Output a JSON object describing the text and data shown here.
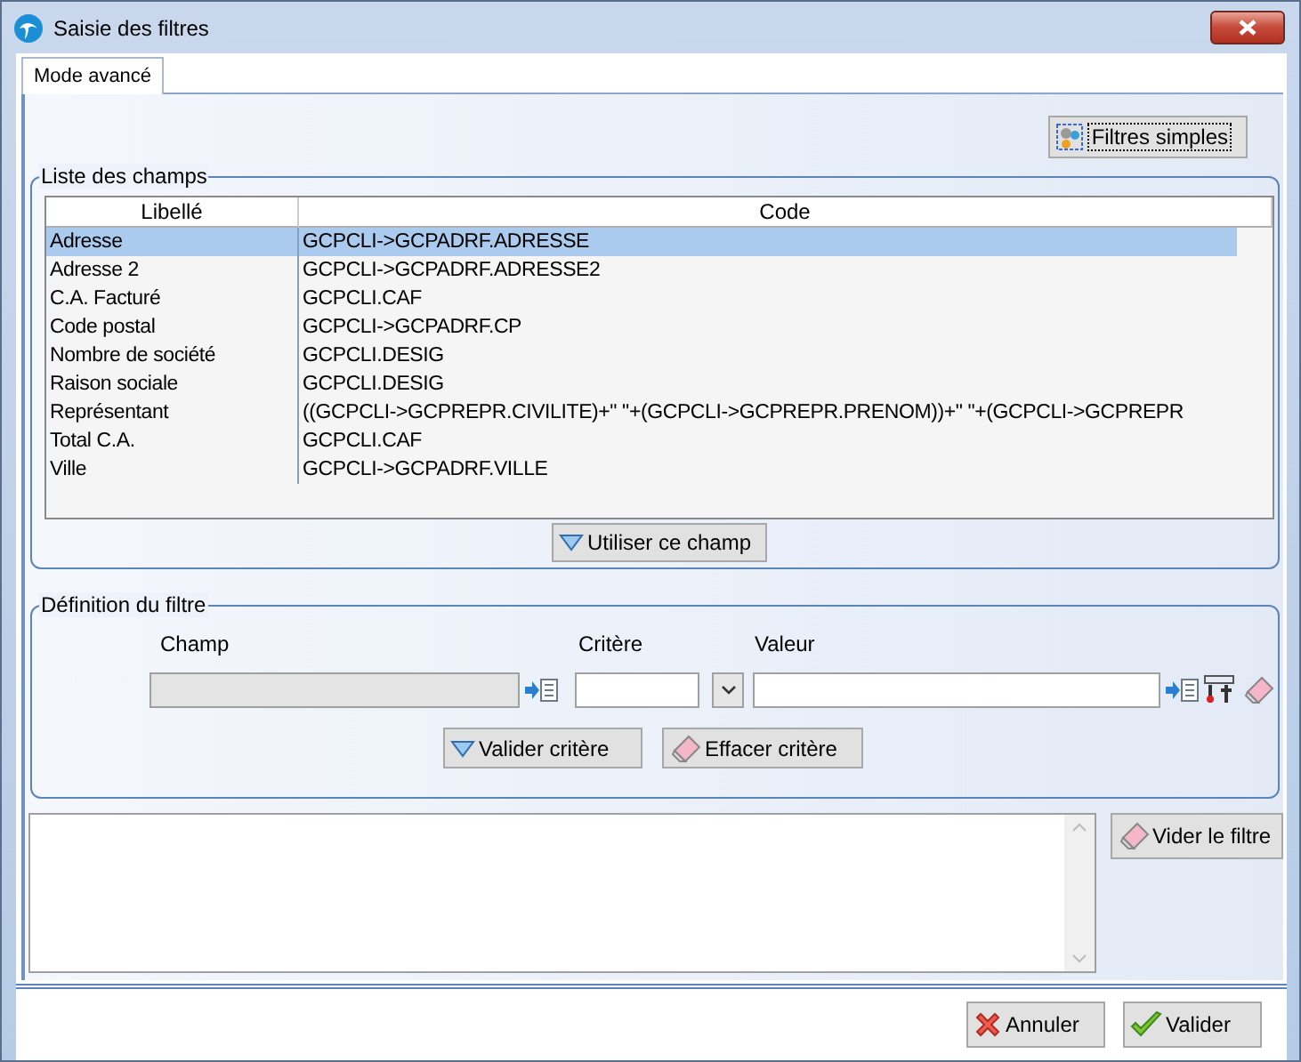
{
  "window": {
    "title": "Saisie des filtres"
  },
  "tabs": [
    {
      "label": "Mode avancé",
      "selected": true
    }
  ],
  "simple_filters_button": "Filtres simples",
  "field_list": {
    "title": "Liste des champs",
    "columns": [
      "Libellé",
      "Code"
    ],
    "rows": [
      {
        "label": "Adresse",
        "code": "GCPCLI->GCPADRF.ADRESSE",
        "selected": true
      },
      {
        "label": "Adresse 2",
        "code": "GCPCLI->GCPADRF.ADRESSE2",
        "selected": false
      },
      {
        "label": "C.A. Facturé",
        "code": "GCPCLI.CAF",
        "selected": false
      },
      {
        "label": "Code postal",
        "code": "GCPCLI->GCPADRF.CP",
        "selected": false
      },
      {
        "label": "Nombre de société",
        "code": "GCPCLI.DESIG",
        "selected": false
      },
      {
        "label": "Raison sociale",
        "code": "GCPCLI.DESIG",
        "selected": false
      },
      {
        "label": "Représentant",
        "code": "((GCPCLI->GCPREPR.CIVILITE)+\" \"+(GCPCLI->GCPREPR.PRENOM))+\" \"+(GCPCLI->GCPREPR",
        "selected": false
      },
      {
        "label": "Total C.A.",
        "code": "GCPCLI.CAF",
        "selected": false
      },
      {
        "label": "Ville",
        "code": "GCPCLI->GCPADRF.VILLE",
        "selected": false
      }
    ],
    "use_button": "Utiliser ce champ"
  },
  "filter_definition": {
    "title": "Définition du filtre",
    "field_label": "Champ",
    "field_disabled": true,
    "criterion_label": "Critère",
    "value_label": "Valeur",
    "validate_button": "Valider critère",
    "clear_button": "Effacer critère"
  },
  "empty_filter_button": "Vider le filtre",
  "footer_buttons": [
    {
      "kind": "cancel",
      "label": "Annuler"
    },
    {
      "kind": "ok",
      "label": "Valider"
    }
  ]
}
